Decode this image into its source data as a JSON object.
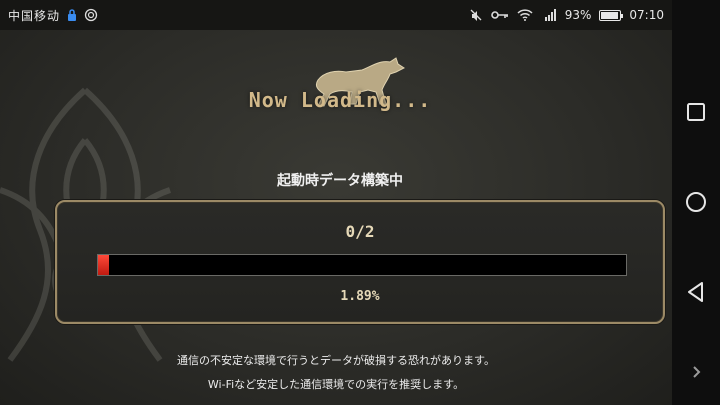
{
  "status_bar": {
    "carrier": "中国移动",
    "battery_percent_text": "93%",
    "battery_level": 0.93,
    "time": "07:10",
    "icons": [
      "lock-icon",
      "sync-icon",
      "mute-icon",
      "key-icon",
      "wifi-icon",
      "cellular-g-icon",
      "battery-icon"
    ],
    "network_type": "G"
  },
  "loading": {
    "title": "Now Loading...",
    "subtitle": "起動時データ構築中",
    "count": "0/2",
    "percent_text": "1.89%",
    "progress_fraction": 0.0189,
    "bar_color": "#e02a1c"
  },
  "notice": {
    "line1": "通信の不安定な環境で行うとデータが破損する恐れがあります。",
    "line2": "Wi-Fiなど安定した通信環境での実行を推奨します。"
  },
  "nav_bar": {
    "icons": [
      "recents-square-icon",
      "home-circle-icon",
      "back-triangle-icon",
      "expand-chevron-icon"
    ]
  },
  "colors": {
    "accent_gold": "#d2b98a",
    "panel_border": "#9c8a66"
  }
}
